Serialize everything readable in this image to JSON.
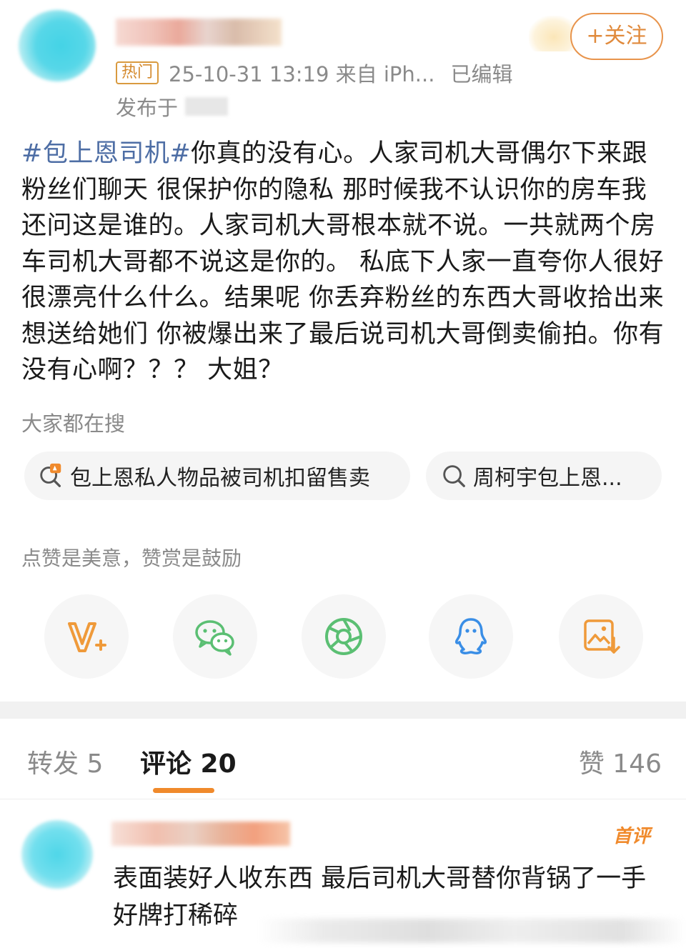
{
  "post": {
    "follow_label": "+关注",
    "hot_tag": "热门",
    "meta": "25-10-31 13:19  来自 iPh...",
    "edited": "已编辑",
    "location_prefix": "发布于",
    "hashtag": "#包上恩司机#",
    "text": "你真的没有心。人家司机大哥偶尔下来跟粉丝们聊天 很保护你的隐私 那时候我不认识你的房车我还问这是谁的。人家司机大哥根本就不说。一共就两个房车司机大哥都不说这是你的。 私底下人家一直夸你人很好很漂亮什么什么。结果呢 你丢弃粉丝的东西大哥收拾出来想送给她们 你被爆出来了最后说司机大哥倒卖偷拍。你有没有心啊？？？ 大姐？"
  },
  "search": {
    "title": "大家都在搜",
    "chips": [
      {
        "label": "包上恩私人物品被司机扣留售卖",
        "icon": "hot-search-icon"
      },
      {
        "label": "周柯宇包上恩...",
        "icon": "search-icon"
      }
    ]
  },
  "reward": {
    "text": "点赞是美意，赞赏是鼓励",
    "share_icons": [
      "reward-v-icon",
      "wechat-icon",
      "moments-icon",
      "qq-icon",
      "save-image-icon"
    ]
  },
  "tabs": {
    "repost": "转发 5",
    "comment": "评论 20",
    "like": "赞 146"
  },
  "comment": {
    "badge": "首评",
    "text": "表面装好人收东西  最后司机大哥替你背锅了一手好牌打稀碎"
  },
  "colors": {
    "accent": "#f08a2c",
    "hashtag": "#4e6ea5",
    "muted": "#8a8a8a",
    "wechat": "#5bbf73",
    "qq": "#3a8ee6"
  }
}
